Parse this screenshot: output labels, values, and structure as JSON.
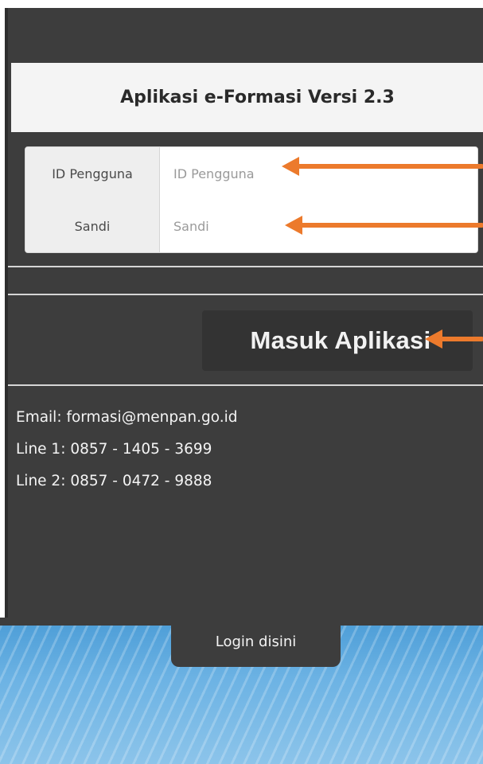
{
  "header": {
    "title": "Aplikasi e-Formasi Versi 2.3"
  },
  "login_form": {
    "user_id": {
      "label": "ID Pengguna",
      "placeholder": "ID Pengguna",
      "value": ""
    },
    "password": {
      "label": "Sandi",
      "placeholder": "Sandi",
      "value": ""
    },
    "submit_label": "Masuk Aplikasi"
  },
  "contact": {
    "email": "Email: formasi@menpan.go.id",
    "line1": "Line 1: 0857 - 1405 - 3699",
    "line2": "Line 2: 0857 - 0472 - 9888"
  },
  "login_tab": {
    "label": "Login disini"
  },
  "colors": {
    "panel_background": "#3d3d3d",
    "annotation_arrow": "#ec7a2c",
    "sky_background": "#6db3e4"
  },
  "annotations": {
    "arrow_icon": "arrow-left-icon",
    "count": 3
  }
}
